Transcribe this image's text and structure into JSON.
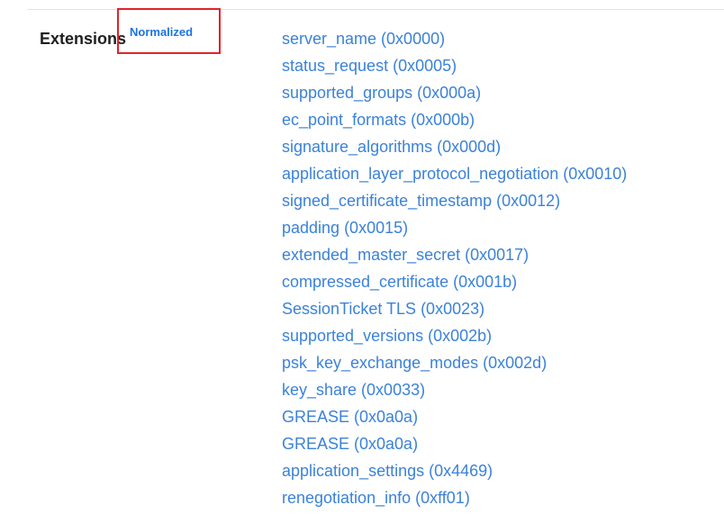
{
  "section": {
    "label": "Extensions",
    "badge": "Normalized",
    "accent_color": "#3b82d8",
    "highlight_color": "#e0232a"
  },
  "extensions": [
    "server_name (0x0000)",
    "status_request (0x0005)",
    "supported_groups (0x000a)",
    "ec_point_formats (0x000b)",
    "signature_algorithms (0x000d)",
    "application_layer_protocol_negotiation (0x0010)",
    "signed_certificate_timestamp (0x0012)",
    "padding (0x0015)",
    "extended_master_secret (0x0017)",
    "compressed_certificate (0x001b)",
    "SessionTicket TLS (0x0023)",
    "supported_versions (0x002b)",
    "psk_key_exchange_modes (0x002d)",
    "key_share (0x0033)",
    "GREASE (0x0a0a)",
    "GREASE (0x0a0a)",
    "application_settings (0x4469)",
    "renegotiation_info (0xff01)"
  ]
}
